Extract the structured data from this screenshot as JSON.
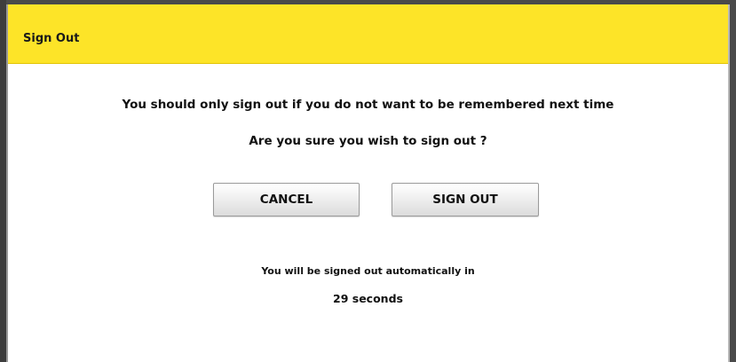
{
  "dialog": {
    "title": "Sign Out",
    "message": "You should only sign out if you do not want to be remembered next time",
    "question": "Are you sure you wish to sign out ?",
    "buttons": {
      "cancel_label": "CANCEL",
      "signout_label": "SIGN OUT"
    },
    "auto_signout_text": "You will be signed out automatically in",
    "countdown_text": "29 seconds"
  },
  "colors": {
    "title_bar": "#fde428",
    "frame": "#4a4a4a",
    "background": "#ffffff"
  }
}
